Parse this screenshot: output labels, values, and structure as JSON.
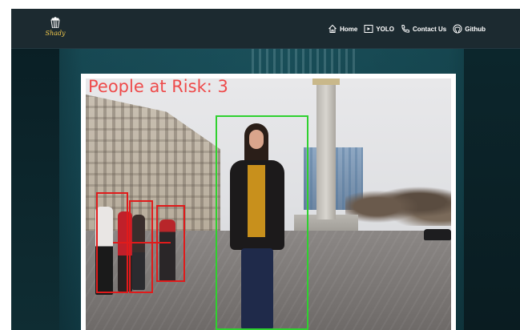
{
  "nav": {
    "logo_text": "Shady",
    "links": [
      {
        "label": "Home",
        "icon": "home-icon"
      },
      {
        "label": "YOLO",
        "icon": "play-icon"
      },
      {
        "label": "Contact Us",
        "icon": "phone-icon"
      },
      {
        "label": "Github",
        "icon": "github-icon"
      }
    ]
  },
  "detection": {
    "label": "People at Risk: 3",
    "safe_color": "#2fd12f",
    "risk_color": "#e01b1b"
  },
  "colors": {
    "nav_bg": "#1c2a30",
    "logo_accent": "#f2c94c"
  }
}
